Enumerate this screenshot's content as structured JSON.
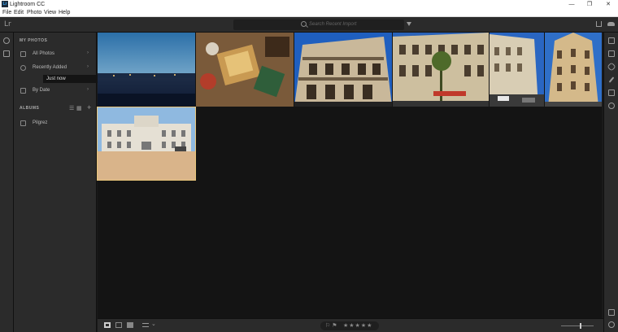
{
  "window": {
    "title": "Lightroom CC",
    "logo_text": "Lr",
    "minimize": "—",
    "maximize": "❐",
    "close": "✕"
  },
  "menu": [
    "File",
    "Edit",
    "Photo",
    "View",
    "Help"
  ],
  "topbar": {
    "brand": "Lr",
    "search_placeholder": "Search Recent Import"
  },
  "sidebar": {
    "my_photos_header": "MY PHOTOS",
    "items": [
      {
        "label": "All Photos",
        "chevron": "›"
      },
      {
        "label": "Recently Added",
        "chevron": "›"
      },
      {
        "label": "By Date",
        "chevron": "›"
      }
    ],
    "selected_sub": {
      "label": "Just now",
      "chevron": "›"
    },
    "albums_header": "ALBUMS",
    "albums_view_list": "☰",
    "albums_view_grid": "▦",
    "albums_add": "+",
    "albums": [
      {
        "label": "Pilgrez"
      }
    ]
  },
  "icons": {
    "left_rail": [
      "sync-icon",
      "library-icon"
    ],
    "right_rail": [
      "edit-sliders-icon",
      "crop-icon",
      "healing-icon",
      "brush-icon",
      "linear-gradient-icon",
      "radial-gradient-icon",
      "tag-icon",
      "info-icon"
    ],
    "bottom": [
      "square-grid-icon",
      "photo-grid-icon",
      "detail-icon",
      "sort-icon"
    ]
  },
  "bottombar": {
    "flags": "⚐ ⚑",
    "stars": "★★★★★",
    "sort_chevron": "⌄"
  },
  "colors": {
    "accent": "#31a8ff",
    "panel": "#2b2b2b",
    "grid_bg": "#141414",
    "selection": "#e8c57a"
  }
}
